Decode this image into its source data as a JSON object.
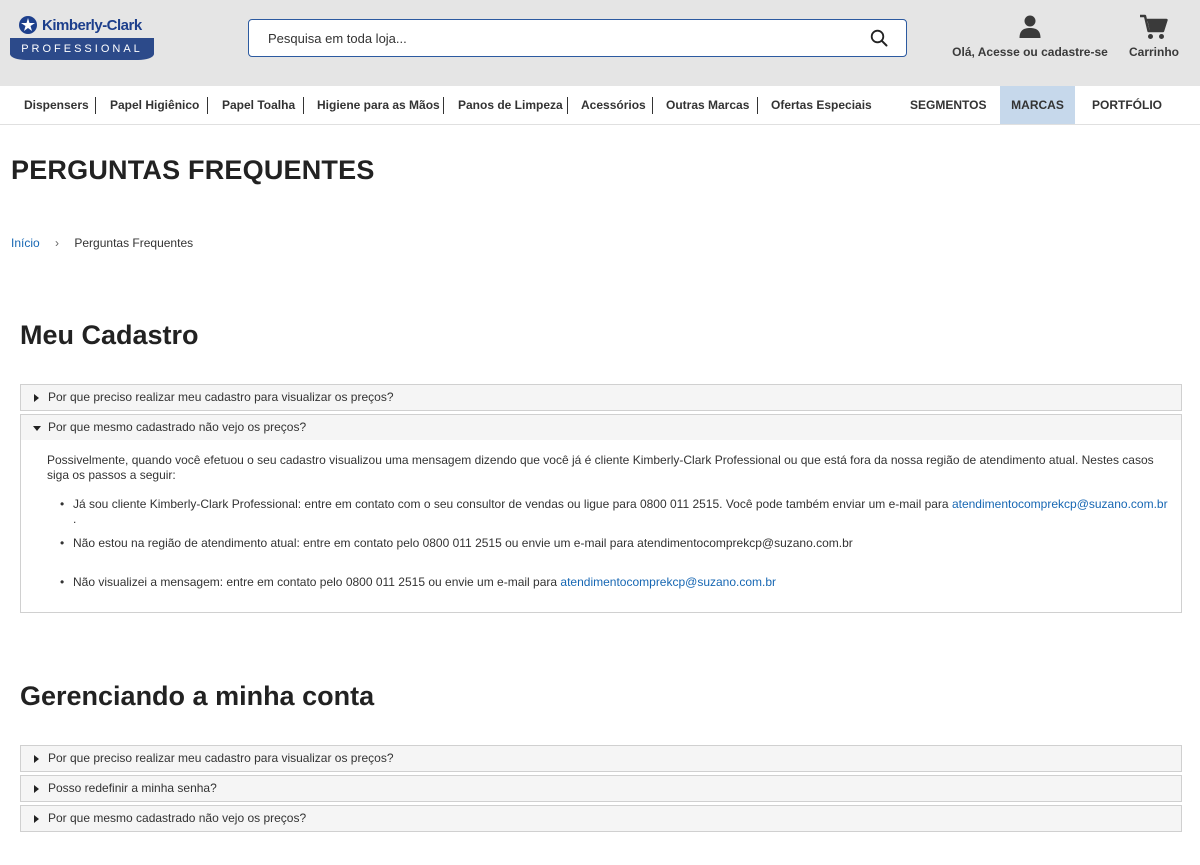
{
  "header": {
    "logo": {
      "brand": "Kimberly-Clark",
      "sub": "PROFESSIONAL"
    },
    "search": {
      "placeholder": "Pesquisa em toda loja..."
    },
    "account_label": "Olá, Acesse ou cadastre-se",
    "cart_label": "Carrinho"
  },
  "nav": {
    "items": [
      "Dispensers",
      "Papel Higiênico",
      "Papel Toalha",
      "Higiene para as Mãos",
      "Panos de Limpeza",
      "Acessórios",
      "Outras Marcas",
      "Ofertas Especiais",
      "SEGMENTOS",
      "MARCAS",
      "PORTFÓLIO"
    ],
    "active": "MARCAS"
  },
  "page": {
    "title": "PERGUNTAS FREQUENTES",
    "breadcrumb": {
      "home": "Início",
      "current": "Perguntas Frequentes"
    }
  },
  "sections": [
    {
      "title": "Meu Cadastro",
      "questions": [
        "Por que preciso realizar meu cadastro para visualizar os preços?",
        "Por que mesmo cadastrado não vejo os preços?"
      ],
      "expanded_answer": {
        "intro": "Possivelmente, quando você efetuou o seu cadastro visualizou uma mensagem dizendo que você já é cliente Kimberly-Clark Professional ou que está fora da nossa região de atendimento atual. Nestes casos siga os passos a seguir:",
        "bullet1_text": "Já sou cliente Kimberly-Clark Professional: entre em contato com o seu consultor de vendas ou ligue para 0800 011 2515. Você pode também enviar um e-mail para",
        "bullet1_link": "atendimentocomprekcp@suzano.com.br",
        "bullet1_end": ".",
        "bullet2_text": "Não estou na região de atendimento atual: entre em contato pelo 0800 011 2515 ou envie um e-mail para atendimentocomprekcp@suzano.com.br",
        "bullet3_text": "Não visualizei a mensagem: entre em contato pelo 0800 011 2515 ou envie um e-mail para",
        "bullet3_link": "atendimentocomprekcp@suzano.com.br"
      }
    },
    {
      "title": "Gerenciando a minha conta",
      "questions": [
        "Por que preciso realizar meu cadastro para visualizar os preços?",
        "Posso redefinir a minha senha?",
        "Por que mesmo cadastrado não vejo os preços?"
      ]
    }
  ],
  "colors": {
    "header_bg": "#e5e5e5",
    "brand_blue": "#2c4a8a",
    "link": "#1767b3",
    "active_nav": "#c6d8eb"
  }
}
